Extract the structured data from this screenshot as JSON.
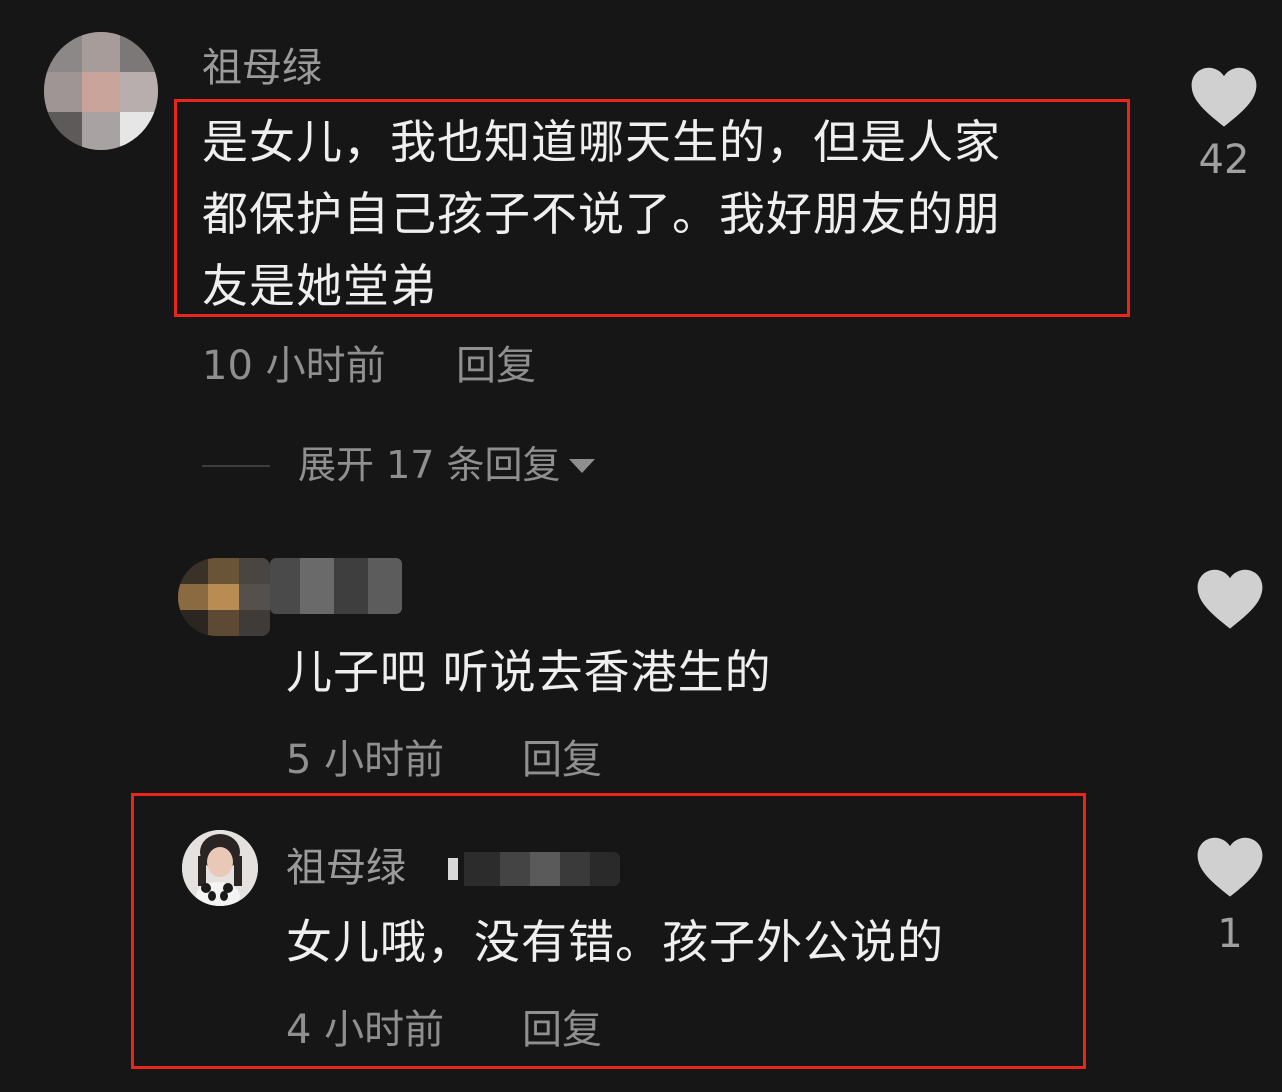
{
  "comments": [
    {
      "username": "祖母绿",
      "text_lines": [
        "是女儿，我也知道哪天生的，但是人家",
        "都保护自己孩子不说了。我好朋友的朋",
        "友是她堂弟"
      ],
      "time": "10 小时前",
      "reply_label": "回复",
      "likes": "42",
      "expand_label": "展开 17 条回复",
      "expand_icon": "caret-down-icon"
    },
    {
      "username": "",
      "text": "儿子吧 听说去香港生的",
      "time": "5 小时前",
      "reply_label": "回复",
      "likes": ""
    },
    {
      "username": "祖母绿",
      "text": "女儿哦，没有错。孩子外公说的",
      "time": "4 小时前",
      "reply_label": "回复",
      "likes": "1"
    }
  ],
  "colors": {
    "background": "#161616",
    "highlight": "#e8261c",
    "text_primary": "#efefef",
    "text_secondary": "#8f8f8f",
    "heart": "#d0d0d0"
  }
}
